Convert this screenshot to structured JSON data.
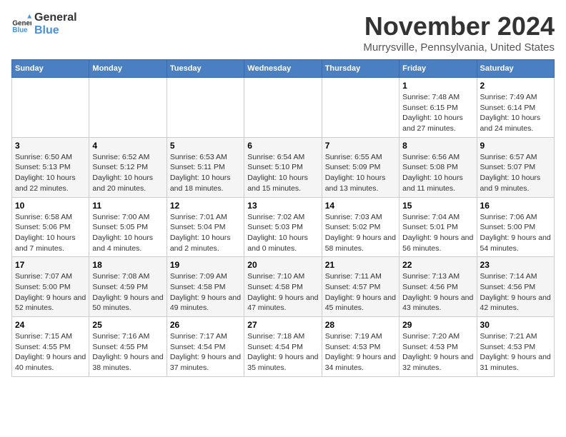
{
  "logo": {
    "text_general": "General",
    "text_blue": "Blue"
  },
  "header": {
    "month": "November 2024",
    "location": "Murrysville, Pennsylvania, United States"
  },
  "days_of_week": [
    "Sunday",
    "Monday",
    "Tuesday",
    "Wednesday",
    "Thursday",
    "Friday",
    "Saturday"
  ],
  "weeks": [
    [
      {
        "day": "",
        "info": ""
      },
      {
        "day": "",
        "info": ""
      },
      {
        "day": "",
        "info": ""
      },
      {
        "day": "",
        "info": ""
      },
      {
        "day": "",
        "info": ""
      },
      {
        "day": "1",
        "info": "Sunrise: 7:48 AM\nSunset: 6:15 PM\nDaylight: 10 hours and 27 minutes."
      },
      {
        "day": "2",
        "info": "Sunrise: 7:49 AM\nSunset: 6:14 PM\nDaylight: 10 hours and 24 minutes."
      }
    ],
    [
      {
        "day": "3",
        "info": "Sunrise: 6:50 AM\nSunset: 5:13 PM\nDaylight: 10 hours and 22 minutes."
      },
      {
        "day": "4",
        "info": "Sunrise: 6:52 AM\nSunset: 5:12 PM\nDaylight: 10 hours and 20 minutes."
      },
      {
        "day": "5",
        "info": "Sunrise: 6:53 AM\nSunset: 5:11 PM\nDaylight: 10 hours and 18 minutes."
      },
      {
        "day": "6",
        "info": "Sunrise: 6:54 AM\nSunset: 5:10 PM\nDaylight: 10 hours and 15 minutes."
      },
      {
        "day": "7",
        "info": "Sunrise: 6:55 AM\nSunset: 5:09 PM\nDaylight: 10 hours and 13 minutes."
      },
      {
        "day": "8",
        "info": "Sunrise: 6:56 AM\nSunset: 5:08 PM\nDaylight: 10 hours and 11 minutes."
      },
      {
        "day": "9",
        "info": "Sunrise: 6:57 AM\nSunset: 5:07 PM\nDaylight: 10 hours and 9 minutes."
      }
    ],
    [
      {
        "day": "10",
        "info": "Sunrise: 6:58 AM\nSunset: 5:06 PM\nDaylight: 10 hours and 7 minutes."
      },
      {
        "day": "11",
        "info": "Sunrise: 7:00 AM\nSunset: 5:05 PM\nDaylight: 10 hours and 4 minutes."
      },
      {
        "day": "12",
        "info": "Sunrise: 7:01 AM\nSunset: 5:04 PM\nDaylight: 10 hours and 2 minutes."
      },
      {
        "day": "13",
        "info": "Sunrise: 7:02 AM\nSunset: 5:03 PM\nDaylight: 10 hours and 0 minutes."
      },
      {
        "day": "14",
        "info": "Sunrise: 7:03 AM\nSunset: 5:02 PM\nDaylight: 9 hours and 58 minutes."
      },
      {
        "day": "15",
        "info": "Sunrise: 7:04 AM\nSunset: 5:01 PM\nDaylight: 9 hours and 56 minutes."
      },
      {
        "day": "16",
        "info": "Sunrise: 7:06 AM\nSunset: 5:00 PM\nDaylight: 9 hours and 54 minutes."
      }
    ],
    [
      {
        "day": "17",
        "info": "Sunrise: 7:07 AM\nSunset: 5:00 PM\nDaylight: 9 hours and 52 minutes."
      },
      {
        "day": "18",
        "info": "Sunrise: 7:08 AM\nSunset: 4:59 PM\nDaylight: 9 hours and 50 minutes."
      },
      {
        "day": "19",
        "info": "Sunrise: 7:09 AM\nSunset: 4:58 PM\nDaylight: 9 hours and 49 minutes."
      },
      {
        "day": "20",
        "info": "Sunrise: 7:10 AM\nSunset: 4:58 PM\nDaylight: 9 hours and 47 minutes."
      },
      {
        "day": "21",
        "info": "Sunrise: 7:11 AM\nSunset: 4:57 PM\nDaylight: 9 hours and 45 minutes."
      },
      {
        "day": "22",
        "info": "Sunrise: 7:13 AM\nSunset: 4:56 PM\nDaylight: 9 hours and 43 minutes."
      },
      {
        "day": "23",
        "info": "Sunrise: 7:14 AM\nSunset: 4:56 PM\nDaylight: 9 hours and 42 minutes."
      }
    ],
    [
      {
        "day": "24",
        "info": "Sunrise: 7:15 AM\nSunset: 4:55 PM\nDaylight: 9 hours and 40 minutes."
      },
      {
        "day": "25",
        "info": "Sunrise: 7:16 AM\nSunset: 4:55 PM\nDaylight: 9 hours and 38 minutes."
      },
      {
        "day": "26",
        "info": "Sunrise: 7:17 AM\nSunset: 4:54 PM\nDaylight: 9 hours and 37 minutes."
      },
      {
        "day": "27",
        "info": "Sunrise: 7:18 AM\nSunset: 4:54 PM\nDaylight: 9 hours and 35 minutes."
      },
      {
        "day": "28",
        "info": "Sunrise: 7:19 AM\nSunset: 4:53 PM\nDaylight: 9 hours and 34 minutes."
      },
      {
        "day": "29",
        "info": "Sunrise: 7:20 AM\nSunset: 4:53 PM\nDaylight: 9 hours and 32 minutes."
      },
      {
        "day": "30",
        "info": "Sunrise: 7:21 AM\nSunset: 4:53 PM\nDaylight: 9 hours and 31 minutes."
      }
    ]
  ]
}
